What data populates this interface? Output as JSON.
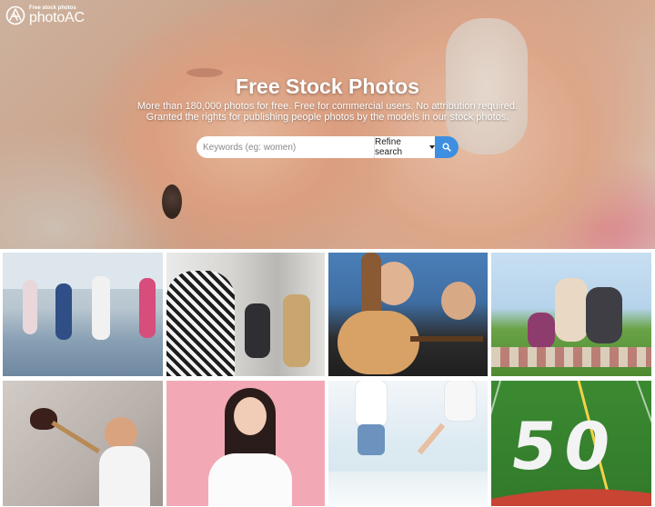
{
  "brand": {
    "sub": "Free stock photos",
    "name": "photoAC",
    "logo_icon": "photoac-logo-icon"
  },
  "hero": {
    "title": "Free Stock Photos",
    "subtitle_line1": "More than 180,000 photos for free. Free for commercial users. No attribution required.",
    "subtitle_line2": "Granted the rights for publishing people photos by the models in our stock photos."
  },
  "search": {
    "placeholder": "Keywords (eg: women)",
    "value": "",
    "refine_label": "Refine search",
    "button_icon": "search-icon",
    "button_color": "#3f8fe0"
  },
  "photos": [
    {
      "subject": "children-running"
    },
    {
      "subject": "business-meeting"
    },
    {
      "subject": "couple-with-guitar"
    },
    {
      "subject": "family-picnic"
    },
    {
      "subject": "girl-with-plunger"
    },
    {
      "subject": "smiling-woman-pink"
    },
    {
      "subject": "couple-on-beach"
    },
    {
      "subject": "football-field-50"
    }
  ],
  "field_number": "50"
}
